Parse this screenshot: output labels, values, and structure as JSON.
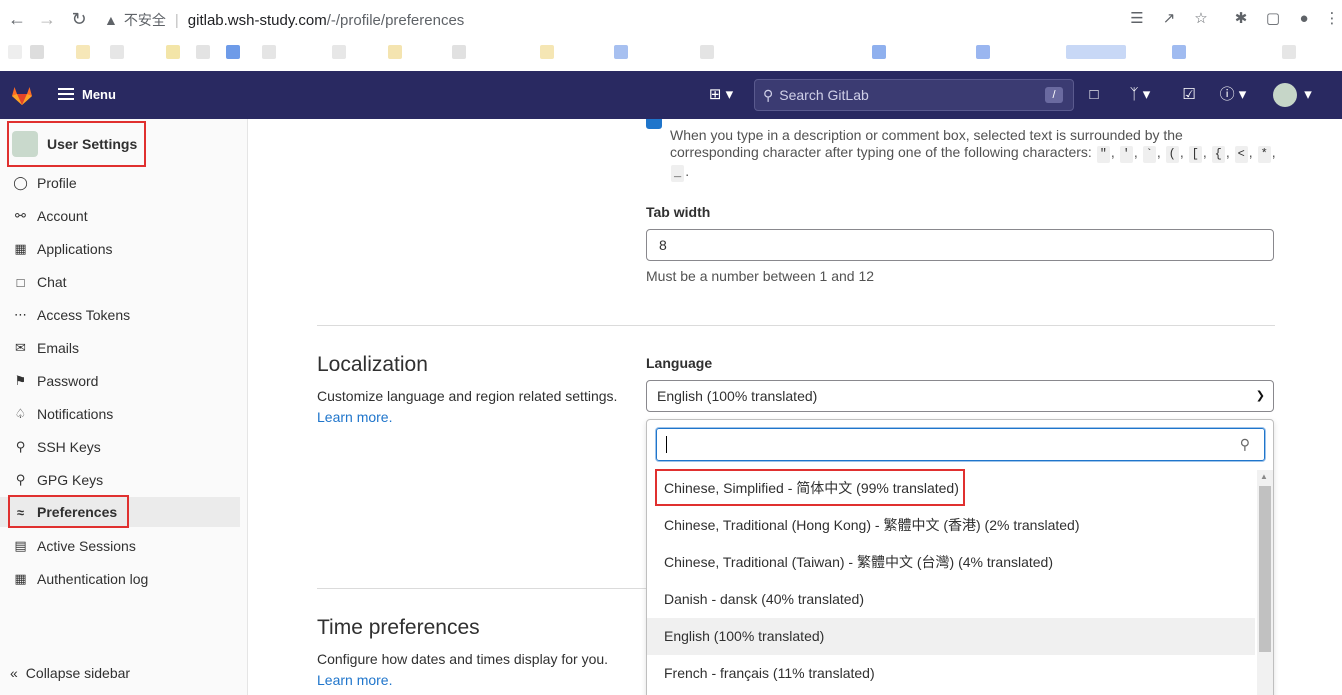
{
  "browser": {
    "insecure_label": "不安全",
    "url_host": "gitlab.wsh-study.com",
    "url_path": "/-/profile/preferences"
  },
  "topnav": {
    "menu_label": "Menu",
    "search_placeholder": "Search GitLab",
    "search_shortcut": "/"
  },
  "sidebar": {
    "title": "User Settings",
    "items": [
      {
        "label": "Profile",
        "icon": "profile-icon"
      },
      {
        "label": "Account",
        "icon": "account-icon"
      },
      {
        "label": "Applications",
        "icon": "applications-icon"
      },
      {
        "label": "Chat",
        "icon": "chat-icon"
      },
      {
        "label": "Access Tokens",
        "icon": "token-icon"
      },
      {
        "label": "Emails",
        "icon": "mail-icon"
      },
      {
        "label": "Password",
        "icon": "lock-icon"
      },
      {
        "label": "Notifications",
        "icon": "bell-icon"
      },
      {
        "label": "SSH Keys",
        "icon": "key-icon"
      },
      {
        "label": "GPG Keys",
        "icon": "key-icon"
      },
      {
        "label": "Preferences",
        "icon": "preferences-icon"
      },
      {
        "label": "Active Sessions",
        "icon": "monitor-icon"
      },
      {
        "label": "Authentication log",
        "icon": "log-icon"
      }
    ],
    "collapse_label": "Collapse sidebar"
  },
  "behavior": {
    "surround_help_1": "When you type in a description or comment box, selected text is surrounded by the",
    "surround_help_2": "corresponding character after typing one of the following characters:",
    "chars": [
      "\"",
      "'",
      "`",
      "(",
      "[",
      "{",
      "<",
      "*",
      "_"
    ],
    "tab_width_label": "Tab width",
    "tab_width_value": "8",
    "tab_width_help": "Must be a number between 1 and 12"
  },
  "localization": {
    "title": "Localization",
    "description": "Customize language and region related settings.",
    "learn_more": "Learn more.",
    "language_label": "Language",
    "selected_language": "English (100% translated)",
    "options": [
      "Chinese, Simplified - 简体中文 (99% translated)",
      "Chinese, Traditional (Hong Kong) - 繁體中文 (香港) (2% translated)",
      "Chinese, Traditional (Taiwan) - 繁體中文 (台灣) (4% translated)",
      "Danish - dansk (40% translated)",
      "English (100% translated)",
      "French - français (11% translated)"
    ]
  },
  "time_preferences": {
    "title": "Time preferences",
    "description": "Configure how dates and times display for you.",
    "learn_more": "Learn more."
  },
  "colors": {
    "navbar": "#292961",
    "highlight_red": "#e0302f",
    "link": "#1f75cb"
  }
}
